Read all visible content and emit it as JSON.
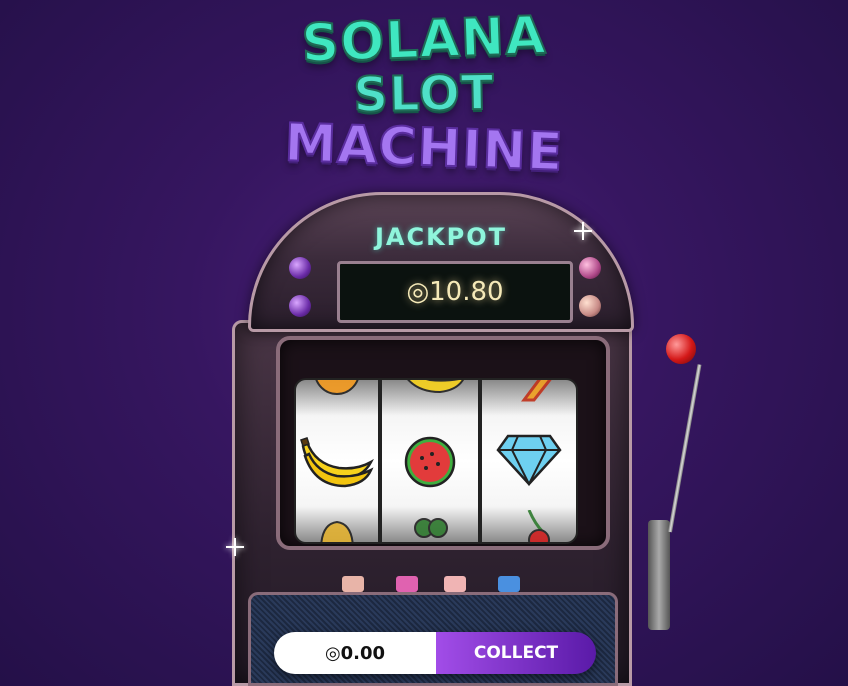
{
  "title": {
    "line1": "SOLANA",
    "line2": "SLOT",
    "line3": "MACHINE"
  },
  "jackpot": {
    "label": "JACKPOT",
    "amount": "◎10.80"
  },
  "reels": [
    {
      "top": "orange",
      "main": "banana",
      "bottom": "bell"
    },
    {
      "top": "banana",
      "main": "watermelon",
      "bottom": "grapes"
    },
    {
      "top": "seven",
      "main": "diamond",
      "bottom": "cherry"
    }
  ],
  "buttons": {
    "colors": [
      "#e8b4a8",
      "#e062b0",
      "#f0b4b4",
      "#4a90e0"
    ]
  },
  "footer": {
    "balance": "◎0.00",
    "collect_label": "COLLECT"
  },
  "colors": {
    "title_teal": "#3fe7c0",
    "title_purple": "#a476f0",
    "collect_start": "#a24de8",
    "collect_end": "#5a1aa8",
    "background": "#361660"
  }
}
